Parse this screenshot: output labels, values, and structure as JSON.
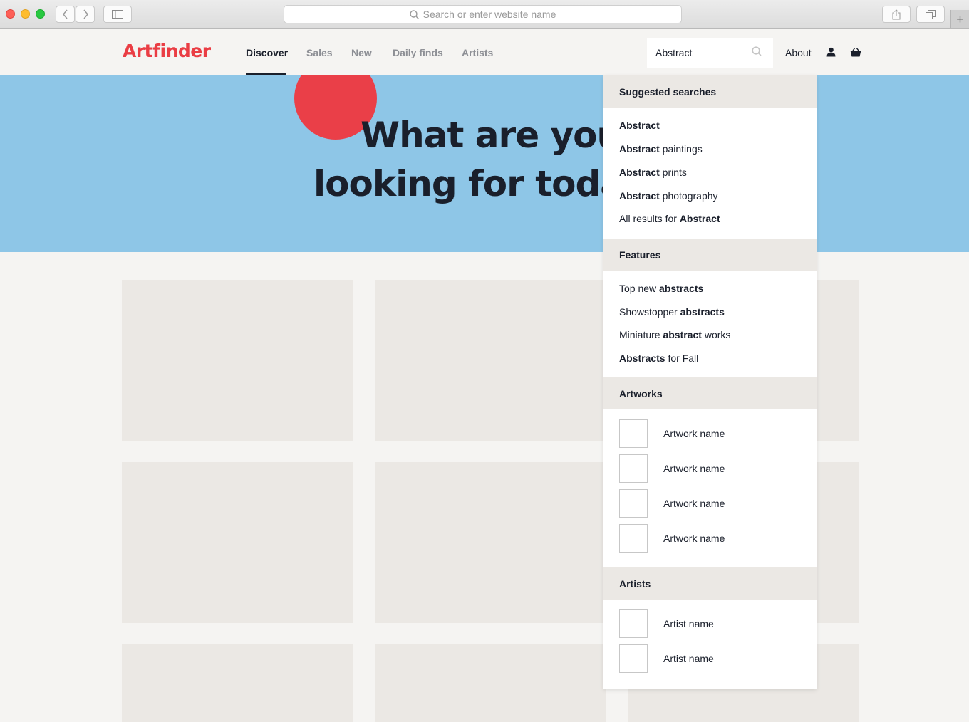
{
  "browser": {
    "address_placeholder": "Search or enter website name"
  },
  "header": {
    "logo": "Artfinder",
    "nav": [
      "Discover",
      "Sales",
      "New",
      "Daily finds",
      "Artists"
    ],
    "search_value": "Abstract",
    "about": "About"
  },
  "hero": {
    "line1": "What are you",
    "line2": "looking for today"
  },
  "dropdown": {
    "suggested_heading": "Suggested searches",
    "suggested": [
      {
        "bold": "Abstract",
        "rest": ""
      },
      {
        "bold": "Abstract",
        "rest": " paintings"
      },
      {
        "bold": "Abstract",
        "rest": " prints"
      },
      {
        "bold": "Abstract",
        "rest": " photography"
      },
      {
        "pre": "All results for ",
        "bold": "Abstract"
      }
    ],
    "features_heading": "Features",
    "features": [
      {
        "pre": "Top new ",
        "bold": "abstracts",
        "post": ""
      },
      {
        "pre": "Showstopper ",
        "bold": "abstracts",
        "post": ""
      },
      {
        "pre": "Miniature ",
        "bold": "abstract",
        "post": " works"
      },
      {
        "pre": "",
        "bold": "Abstracts",
        "post": " for Fall"
      }
    ],
    "artworks_heading": "Artworks",
    "artworks": [
      "Artwork name",
      "Artwork name",
      "Artwork name",
      "Artwork name"
    ],
    "artists_heading": "Artists",
    "artists": [
      "Artist name",
      "Artist name"
    ]
  }
}
